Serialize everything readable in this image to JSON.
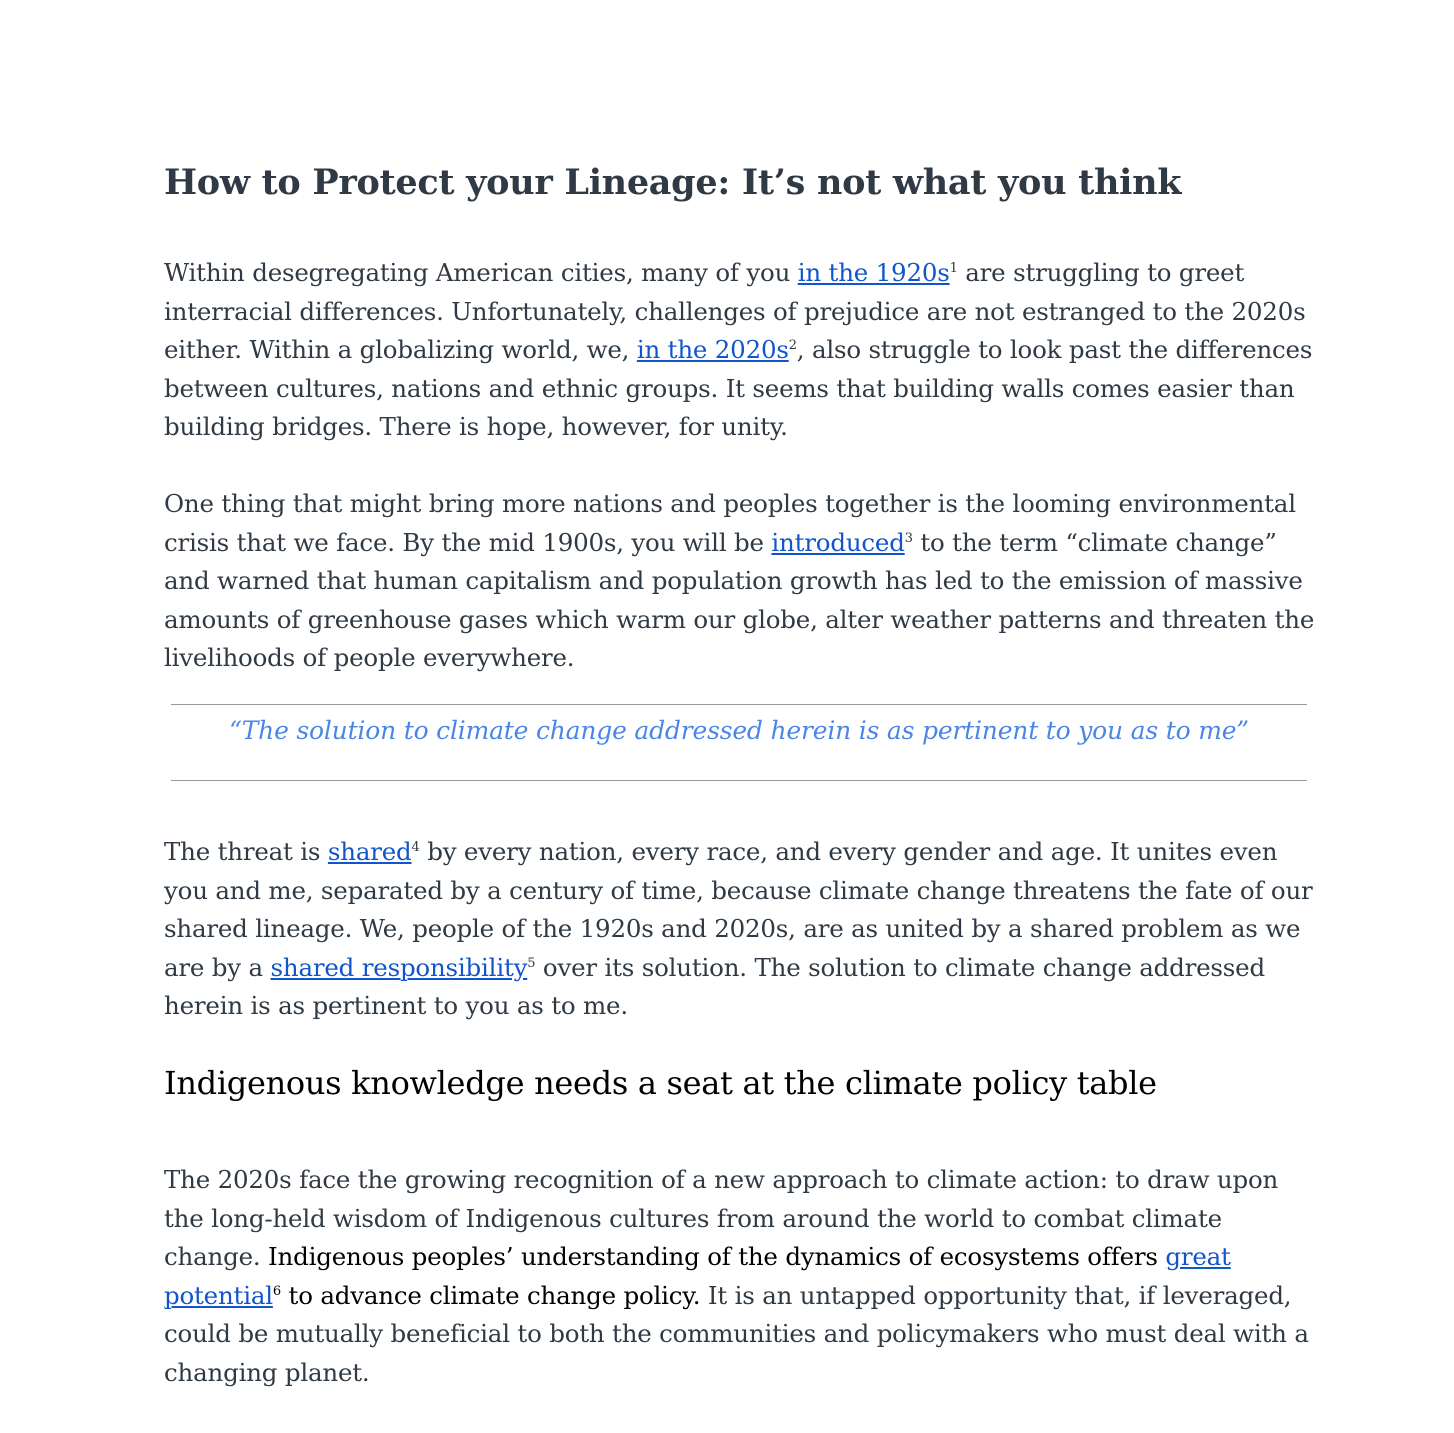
{
  "title": "How to Protect your Lineage: It’s not what you think",
  "p1": {
    "t1": "Within desegregating American cities, many of you ",
    "l1": "in the 1920s",
    "s1": "1",
    "t2": " are struggling to greet interracial differences. Unfortunately, challenges of prejudice are not estranged to the 2020s either. Within a globalizing world, we, ",
    "l2": "in the 2020s",
    "s2": "2",
    "t3": ", also struggle to look past the differences between cultures, nations and ethnic groups. It seems that building walls comes easier than building bridges. There is hope, however, for unity."
  },
  "p2": {
    "t1": "One thing that might bring more nations and peoples together is the looming environmental crisis that we face. By the mid 1900s, you will be ",
    "l1": "introduced",
    "s1": "3",
    "t2": " to the term “climate change” and warned that human capitalism and population growth has led to the emission of massive amounts of greenhouse gases which warm our globe, alter weather patterns and threaten the livelihoods of people everywhere."
  },
  "quote": "“The solution to climate change addressed herein is as pertinent to you as to me”",
  "p3": {
    "t1": "The threat is ",
    "l1": "shared",
    "s1": "4",
    "t2": " by every nation, every race, and every gender and age. It unites even you and me, separated by a century of time, because climate change threatens the fate of our shared lineage. We, people of the 1920s and 2020s, are as united by a shared problem as we are by a ",
    "l2": "shared responsibility",
    "s2": "5",
    "t3": " over its solution. The solution to climate change addressed herein is as pertinent to you as to me."
  },
  "subheading": "Indigenous knowledge needs a seat at the climate policy table",
  "p4": {
    "t1": "The 2020s face the growing recognition of a new approach to climate action: to draw upon the long-held wisdom of Indigenous cultures from around the world to combat climate change. ",
    "b1": "Indigenous peoples’ understanding of the dynamics of ecosystems offers ",
    "l1": "great potential",
    "s1": "6",
    "b2": " to advance climate change policy.",
    "t2": " It is an untapped opportunity that, if leveraged, could be mutually beneficial to both the communities and policymakers who must deal with a changing planet."
  },
  "colors": {
    "text": "#2f3a44",
    "link": "#1155cc",
    "quote": "#4a86e8"
  }
}
